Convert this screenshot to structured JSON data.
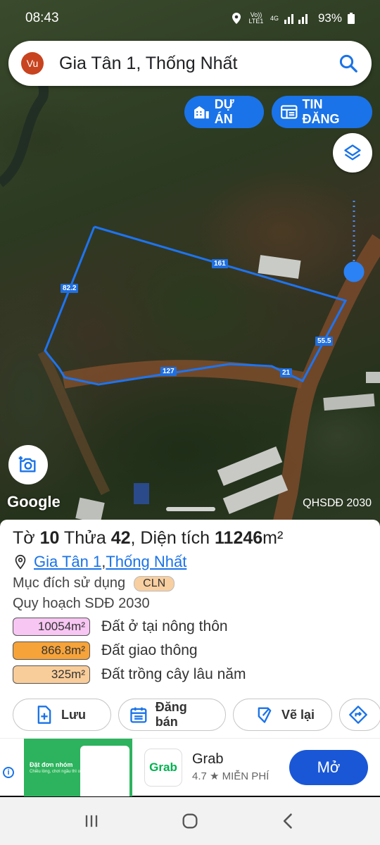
{
  "status_bar": {
    "time": "08:43",
    "network": "Vo)) LTE1",
    "signal": "4G",
    "battery": "93%"
  },
  "search": {
    "avatar": "Vu",
    "query": "Gia Tân 1, Thống Nhất",
    "icon": "search-icon"
  },
  "top_buttons": {
    "du_an": "DỰ ÁN",
    "tin_dang": "TIN ĐĂNG"
  },
  "map": {
    "segment_labels": [
      "161",
      "82.2",
      "55.5",
      "127",
      "21"
    ],
    "google": "Google",
    "plan_label": "QHSDĐ 2030",
    "parcel_color": "#1e74f0"
  },
  "parcel": {
    "prefix_to": "Tờ ",
    "to": "10",
    "prefix_thua": " Thửa ",
    "thua": "42",
    "prefix_area": ", Diện tích ",
    "area": "11246",
    "unit": "m²",
    "ward": "Gia Tân 1",
    "comma": ", ",
    "district": "Thống Nhất",
    "purpose_label": "Mục đích sử dụng",
    "purpose_code": "CLN",
    "plan_label": "Quy hoạch SDĐ 2030",
    "zones": [
      {
        "area": "10054m²",
        "label": "Đất ở tại nông thôn",
        "color": "#f7c6f3"
      },
      {
        "area": "866.8m²",
        "label": "Đất giao thông",
        "color": "#f6a33a"
      },
      {
        "area": "325m²",
        "label": "Đất trồng cây lâu năm",
        "color": "#f9cd9a"
      }
    ]
  },
  "actions": {
    "save": "Lưu",
    "sell": "Đăng bán",
    "redraw": "Vẽ lại"
  },
  "ad": {
    "banner_title": "Đặt đơn nhóm",
    "banner_sub": "Chiều lòng, chơi ngầu thì ok",
    "app": "Grab",
    "logo": "Grab",
    "rating": "4.7 ★",
    "price": "MIỄN PHÍ",
    "cta": "Mở"
  }
}
